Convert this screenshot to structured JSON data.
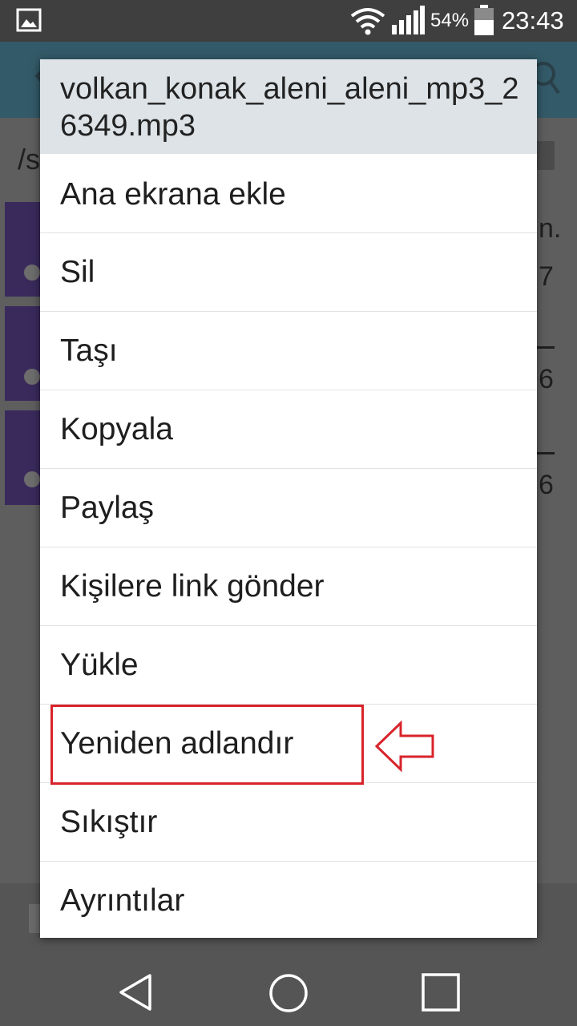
{
  "status_bar": {
    "battery_percent": "54%",
    "time": "23:43",
    "icons": [
      "gallery-icon",
      "wifi-icon",
      "signal-icon",
      "battery-icon"
    ]
  },
  "background_app": {
    "path_prefix": "/s",
    "row_suffixes": [
      "n.",
      "7",
      "6",
      "6"
    ]
  },
  "dialog": {
    "title": "volkan_konak_aleni_aleni_mp3_26349.mp3",
    "items": [
      "Ana ekrana ekle",
      "Sil",
      "Taşı",
      "Kopyala",
      "Paylaş",
      "Kişilere link gönder",
      "Yükle",
      "Yeniden adlandır",
      "Sıkıştır",
      "Ayrıntılar"
    ],
    "highlighted_item": "Yeniden adlandır"
  },
  "colors": {
    "annotation": "#d9232a",
    "title_bg": "#dde3e7",
    "thumb": "#3a2a5c"
  },
  "navigation": {
    "icons": [
      "back-icon",
      "home-icon",
      "recents-icon"
    ]
  }
}
